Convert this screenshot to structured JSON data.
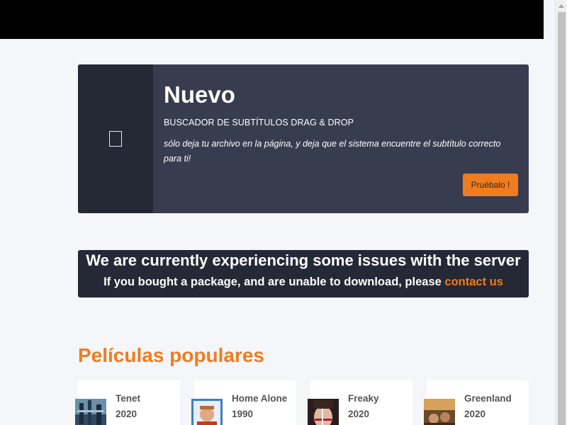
{
  "promo": {
    "title": "Nuevo",
    "subtitle": "BUSCADOR DE SUBTÍTULOS DRAG & DROP",
    "description": "sólo deja tu archivo en la página, y deja que el sistema encuentre el subtítulo correcto para ti!",
    "button_label": "Pruébalo !"
  },
  "notice": {
    "title": "We are currently experiencing some issues with the server",
    "text": "If you bought a package, and are unable to download, please ",
    "link_label": "contact us"
  },
  "popular": {
    "title": "Películas populares",
    "movies": [
      {
        "name": "Tenet",
        "year": "2020"
      },
      {
        "name": "Home Alone",
        "year": "1990"
      },
      {
        "name": "Freaky",
        "year": "2020"
      },
      {
        "name": "Greenland",
        "year": "2020"
      }
    ]
  },
  "colors": {
    "accent": "#f07c1f",
    "dark": "#252835",
    "promo_bg": "#383c4f"
  }
}
